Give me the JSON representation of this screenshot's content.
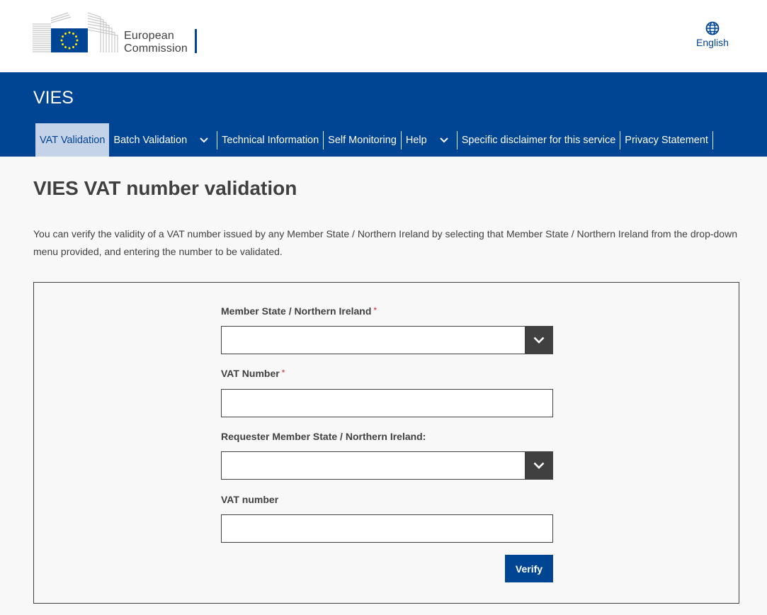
{
  "header": {
    "logo_line1": "European",
    "logo_line2": "Commission",
    "language": "English"
  },
  "band": {
    "site_name": "VIES",
    "nav": [
      {
        "label": "VAT Validation",
        "active": true,
        "dropdown": false
      },
      {
        "label": "Batch Validation",
        "active": false,
        "dropdown": true
      },
      {
        "label": "Technical Information",
        "active": false,
        "dropdown": false
      },
      {
        "label": "Self Monitoring",
        "active": false,
        "dropdown": false
      },
      {
        "label": "Help",
        "active": false,
        "dropdown": true
      },
      {
        "label": "Specific disclaimer for this service",
        "active": false,
        "dropdown": false
      },
      {
        "label": "Privacy Statement",
        "active": false,
        "dropdown": false
      }
    ]
  },
  "main": {
    "title": "VIES VAT number validation",
    "intro": "You can verify the validity of a VAT number issued by any Member State / Northern Ireland by selecting that Member State / Northern Ireland from the drop-down menu provided, and entering the number to be validated."
  },
  "form": {
    "member_state_label": "Member State / Northern Ireland",
    "member_state_value": "",
    "vat_number_label": "VAT Number",
    "vat_number_value": "",
    "requester_state_label": "Requester Member State / Northern Ireland:",
    "requester_state_value": "",
    "requester_vat_label": "VAT number",
    "requester_vat_value": "",
    "required_mark": "*",
    "verify_label": "Verify"
  },
  "colors": {
    "brand_blue": "#004494",
    "active_tab": "#c5d3e8",
    "dark_grey": "#404040",
    "required_red": "#da2131",
    "eu_yellow": "#ffed00"
  }
}
